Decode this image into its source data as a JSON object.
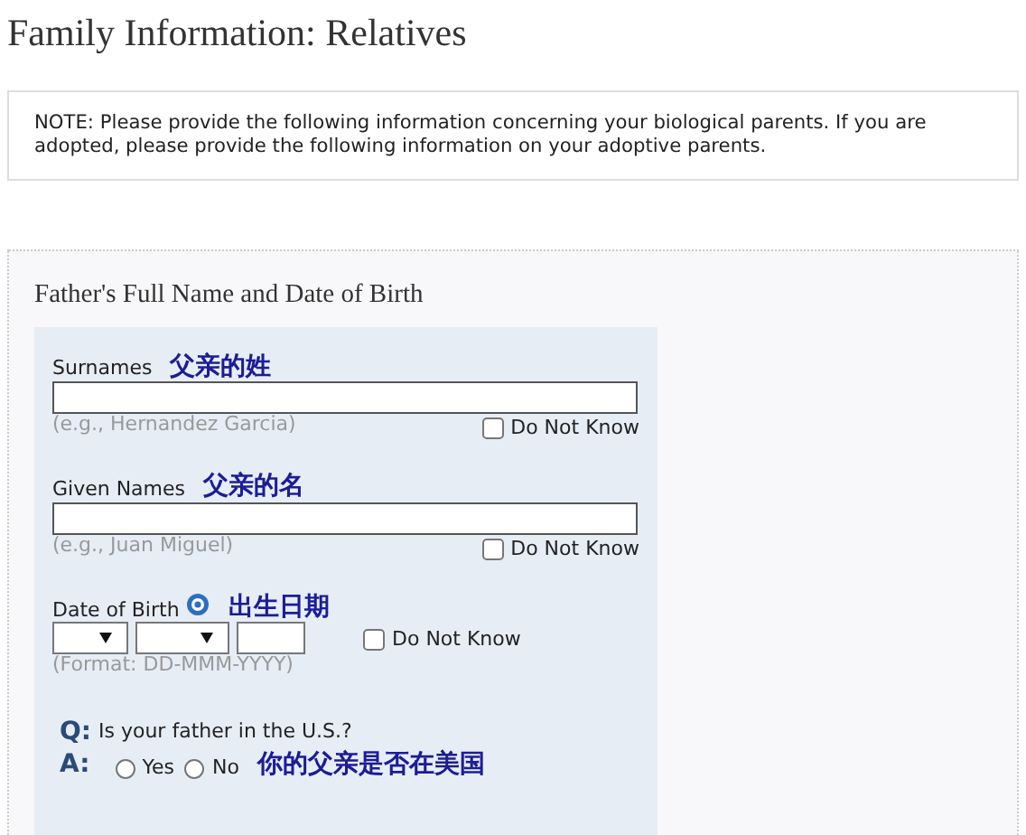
{
  "title": "Family Information: Relatives",
  "note": "NOTE: Please provide the following information concerning your biological parents. If you are adopted, please provide the following information on your adoptive parents.",
  "section": {
    "heading": "Father's Full Name and Date of Birth",
    "fields": [
      {
        "kind": "text",
        "label": "Surnames",
        "annotation": "父亲的姓",
        "hint": "(e.g., Hernandez Garcia)",
        "dont_know": {
          "label": "Do Not Know",
          "checked": false
        }
      },
      {
        "kind": "text",
        "label": "Given Names",
        "annotation": "父亲的名",
        "hint": "(e.g., Juan Miguel)",
        "dont_know": {
          "label": "Do Not Know",
          "checked": false
        }
      },
      {
        "kind": "date",
        "label": "Date of Birth",
        "annotation": "出生日期",
        "hint": "(Format: DD-MMM-YYYY)",
        "dont_know": {
          "label": "Do Not Know",
          "checked": false
        }
      }
    ],
    "question": {
      "q": "Q:",
      "text": "Is your father in the U.S.?",
      "a": "A:",
      "annotation": "你的父亲是否在美国",
      "options": [
        {
          "label": "Yes",
          "selected": false
        },
        {
          "label": "No",
          "selected": false
        }
      ]
    }
  }
}
